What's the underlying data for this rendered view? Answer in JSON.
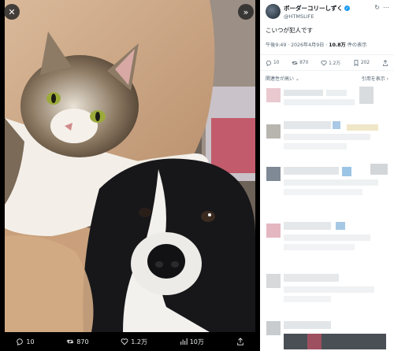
{
  "viewer": {
    "reply_count": "10",
    "retweet_count": "870",
    "like_count": "1.2万",
    "view_count": "10万"
  },
  "tweet": {
    "display_name": "ボーダーコリーしずく",
    "handle": "@HTMSLIFE",
    "text": "こいつが犯人です",
    "time": "午後9:49 · 2026年4月9日 · ",
    "views_value": "10.8万",
    "views_suffix": " 件の表示",
    "stats": {
      "replies": "10",
      "retweets": "870",
      "likes": "1.2万",
      "bookmarks": "202"
    },
    "sort_label": "関連性が高い ⌄",
    "quote_label": "引用を表示 ›"
  },
  "colors": {
    "accent": "#1d9bf0",
    "muted": "#536471",
    "text": "#0f1419"
  }
}
